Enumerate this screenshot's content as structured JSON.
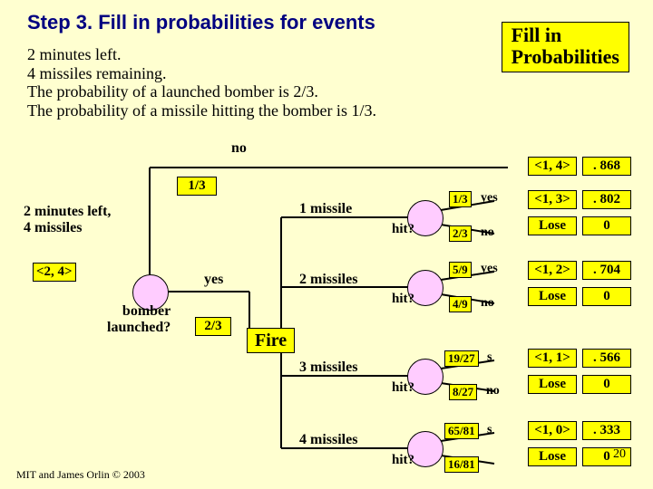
{
  "title": "Step 3.  Fill in probabilities for events",
  "badge_line1": "Fill in",
  "badge_line2": "Probabilities",
  "context": {
    "l1": "2 minutes left.",
    "l2": "4 missiles remaining.",
    "l3": "The probability of a launched bomber is 2/3.",
    "l4": "The probability of a missile hitting the bomber is 1/3."
  },
  "labels": {
    "no": "no",
    "yes": "yes",
    "no_top_prob": "1/3",
    "yes_bottom_prob": "2/3",
    "state_left": "2 minutes left,\n4 missiles",
    "state_tag": "<2, 4>",
    "bomber": "bomber\nlaunched?",
    "fire": "Fire",
    "hit": "hit?",
    "m1": "1 missile",
    "m2": "2 missiles",
    "m3": "3 missiles",
    "m4": "4 missiles"
  },
  "branches": [
    {
      "pyes": "1/3",
      "pno": "2/3",
      "state": "<1, 3>",
      "win": ". 802"
    },
    {
      "pyes": "5/9",
      "pno": "4/9",
      "state": "<1, 2>",
      "win": ". 704"
    },
    {
      "pyes": "19/27",
      "pno": "8/27",
      "state": "<1, 1>",
      "win": ". 566"
    },
    {
      "pyes": "65/81",
      "pno": "16/81",
      "state": "<1, 0>",
      "win": ". 333"
    }
  ],
  "top_outcome": {
    "state": "<1, 4>",
    "val": ". 868"
  },
  "lose": "Lose",
  "zero": "0",
  "footer": "MIT and James Orlin © 2003",
  "slidenum": "20"
}
